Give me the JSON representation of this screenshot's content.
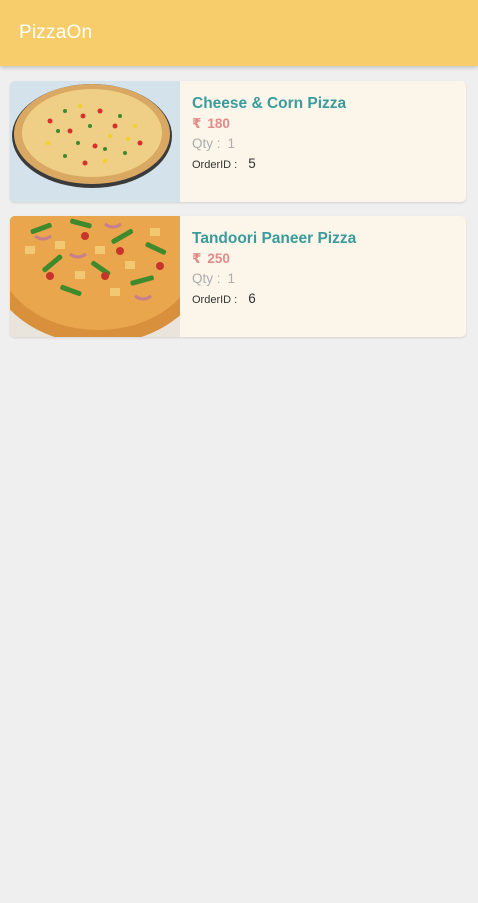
{
  "app": {
    "title": "PizzaOn"
  },
  "colors": {
    "app_bar": "#f6cd6a",
    "card_background": "#fcf6ea",
    "pizza_name": "#3a9a9c",
    "price": "#e08a8a",
    "qty": "#adadad"
  },
  "orders": [
    {
      "name": "Cheese & Corn Pizza",
      "currency": "₹",
      "price": "180",
      "qty_label": "Qty :",
      "qty": "1",
      "order_id_label": "OrderID :",
      "order_id": "5",
      "image_icon": "cheese-corn-pizza-image"
    },
    {
      "name": "Tandoori Paneer Pizza",
      "currency": "₹",
      "price": "250",
      "qty_label": "Qty :",
      "qty": "1",
      "order_id_label": "OrderID :",
      "order_id": "6",
      "image_icon": "tandoori-paneer-pizza-image"
    }
  ]
}
